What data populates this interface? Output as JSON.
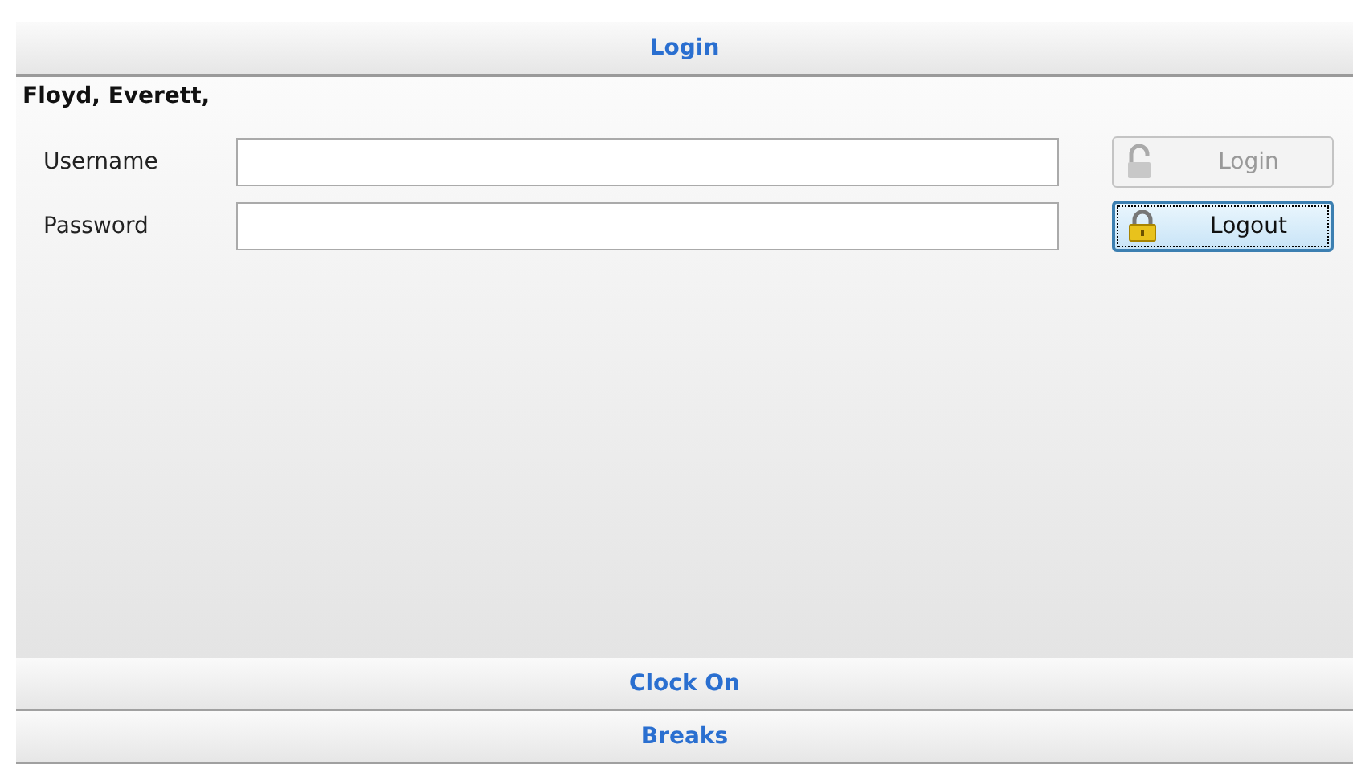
{
  "sections": [
    {
      "title": "Login",
      "expanded": true
    },
    {
      "title": "Clock On",
      "expanded": false
    },
    {
      "title": "Breaks",
      "expanded": false
    }
  ],
  "login_panel": {
    "user_name": "Floyd, Everett,",
    "fields": [
      {
        "label": "Username"
      },
      {
        "label": "Password"
      }
    ],
    "buttons": [
      {
        "label": "Login",
        "kind": "unlock",
        "disabled": true,
        "focused": false
      },
      {
        "label": "Logout",
        "kind": "lock",
        "disabled": false,
        "focused": true
      }
    ]
  }
}
